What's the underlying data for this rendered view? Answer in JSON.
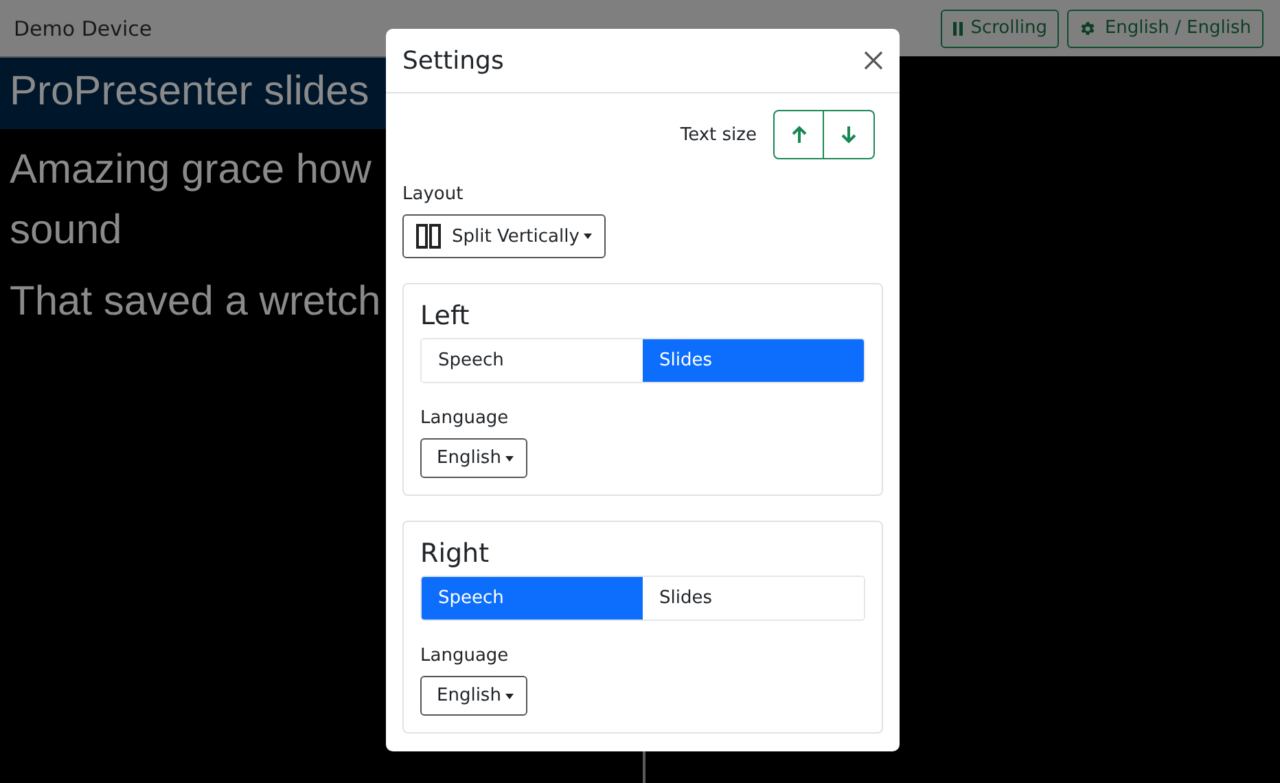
{
  "navbar": {
    "title": "Demo Device",
    "buttons": [
      {
        "kind": "pause",
        "label": "Scrolling"
      },
      {
        "kind": "gear",
        "label": "English / English"
      }
    ]
  },
  "pane": {
    "header": "ProPresenter slides",
    "paragraphs": [
      {
        "lines": [
          "Amazing grace how",
          "sound"
        ]
      },
      {
        "lines": [
          "That saved a wretch"
        ]
      }
    ]
  },
  "modal": {
    "title": "Settings",
    "text_size": {
      "label": "Text size"
    },
    "layout": {
      "label": "Layout",
      "value": "Split Vertically"
    },
    "sections": [
      {
        "title": "Left",
        "options": [
          {
            "label": "Speech",
            "selected": false
          },
          {
            "label": "Slides",
            "selected": true
          }
        ],
        "language_label": "Language",
        "language": "English"
      },
      {
        "title": "Right",
        "options": [
          {
            "label": "Speech",
            "selected": true
          },
          {
            "label": "Slides",
            "selected": false
          }
        ],
        "language_label": "Language",
        "language": "English"
      }
    ]
  }
}
